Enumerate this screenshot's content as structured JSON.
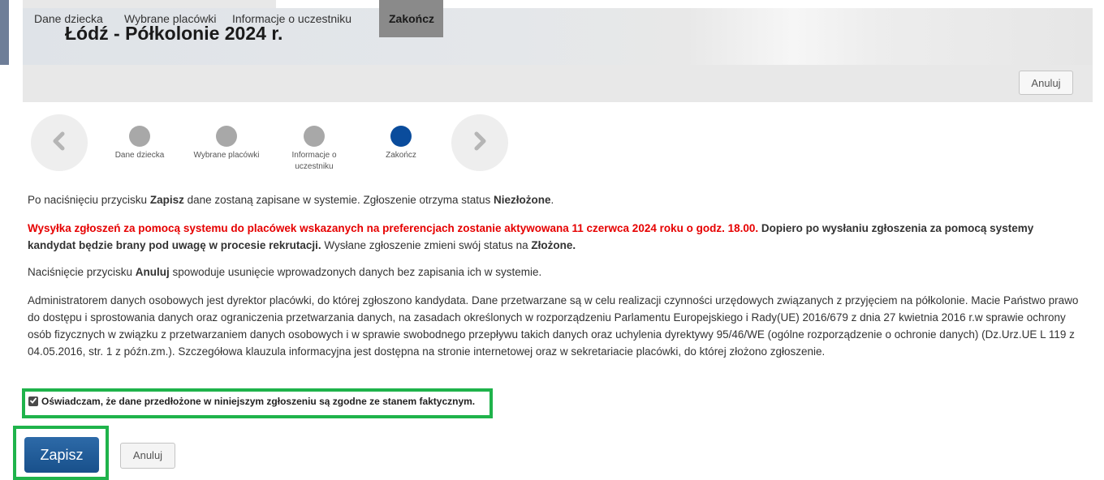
{
  "header": {
    "title": "Łódź - Półkolonie 2024 r."
  },
  "nav": {
    "items": [
      {
        "label": "Dane dziecka"
      },
      {
        "label": "Wybrane placówki"
      },
      {
        "label": "Informacje o uczestniku"
      },
      {
        "label": "Zakończ"
      }
    ],
    "cancel_label": "Anuluj"
  },
  "steps": {
    "items": [
      {
        "label": "Dane dziecka",
        "state": "done"
      },
      {
        "label": "Wybrane placówki",
        "state": "done"
      },
      {
        "label": "Informacje o uczestniku",
        "state": "done"
      },
      {
        "label": "Zakończ",
        "state": "current"
      }
    ],
    "prev_icon": "chevron-left-icon",
    "next_icon": "chevron-right-icon"
  },
  "content": {
    "p1": {
      "a": "Po naciśnięciu przycisku ",
      "b": "Zapisz",
      "c": " dane zostaną zapisane w systemie.  Zgłoszenie otrzyma status ",
      "d": "Niezłożone",
      "e": "."
    },
    "p2": {
      "red": "Wysyłka zgłoszeń za pomocą systemu do placówek wskazanych na preferencjach zostanie aktywowana 11 czerwca 2024 roku o godz. 18.00.",
      "bold": " Dopiero po wysłaniu zgłoszenia za pomocą systemy kandydat będzie brany pod uwagę w procesie rekrutacji.",
      "normal": " Wysłane zgłoszenie zmieni swój status na ",
      "status": "Złożone."
    },
    "p3": {
      "a": "Naciśnięcie przycisku ",
      "b": "Anuluj",
      "c": " spowoduje usunięcie wprowadzonych danych bez zapisania ich w systemie."
    },
    "p4": "Administratorem danych osobowych jest dyrektor placówki, do której zgłoszono kandydata. Dane przetwarzane są w celu realizacji czynności urzędowych związanych z przyjęciem na półkolonie. Macie Państwo prawo do dostępu i sprostowania danych oraz ograniczenia przetwarzania danych, na zasadach określonych w rozporządzeniu Parlamentu Europejskiego i Rady(UE) 2016/679 z dnia 27 kwietnia 2016 r.w sprawie ochrony osób fizycznych w związku z przetwarzaniem danych osobowych i w sprawie swobodnego przepływu takich danych oraz uchylenia dyrektywy 95/46/WE (ogólne rozporządzenie o ochronie danych) (Dz.Urz.UE L 119 z 04.05.2016, str. 1 z późn.zm.). Szczegółowa klauzula informacyjna jest dostępna na stronie internetowej oraz w sekretariacie placówki, do której złożono zgłoszenie."
  },
  "declaration": {
    "label": "Oświadczam, że dane przedłożone w niniejszym zgłoszeniu są zgodne ze stanem faktycznym.",
    "checked": true
  },
  "actions": {
    "save_label": "Zapisz",
    "cancel_label": "Anuluj"
  },
  "colors": {
    "accent": "#0a4c9c",
    "warning": "#e60000",
    "highlight": "#1fb34b"
  }
}
